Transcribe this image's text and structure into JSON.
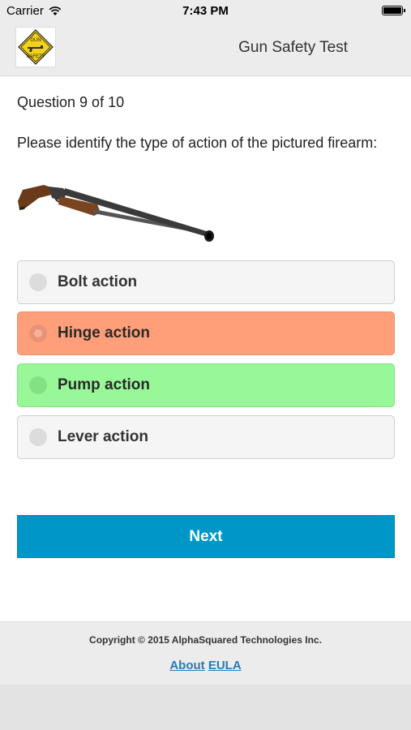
{
  "status_bar": {
    "carrier": "Carrier",
    "time": "7:43 PM"
  },
  "header": {
    "title": "Gun Safety Test",
    "logo_text_top": "GUN",
    "logo_text_bottom": "SAFETY"
  },
  "question": {
    "counter": "Question 9 of 10",
    "text": "Please identify the type of action of the pictured firearm:",
    "image_icon": "shotgun-image"
  },
  "options": [
    {
      "label": "Bolt action",
      "state": "neutral"
    },
    {
      "label": "Hinge action",
      "state": "wrong"
    },
    {
      "label": "Pump action",
      "state": "correct"
    },
    {
      "label": "Lever action",
      "state": "neutral"
    }
  ],
  "next_label": "Next",
  "footer": {
    "copyright": "Copyright © 2015 AlphaSquared Technologies Inc.",
    "about_label": "About",
    "eula_label": "EULA"
  },
  "colors": {
    "wrong": "#ff9f7a",
    "correct": "#98f898",
    "primary": "#0097c8"
  }
}
